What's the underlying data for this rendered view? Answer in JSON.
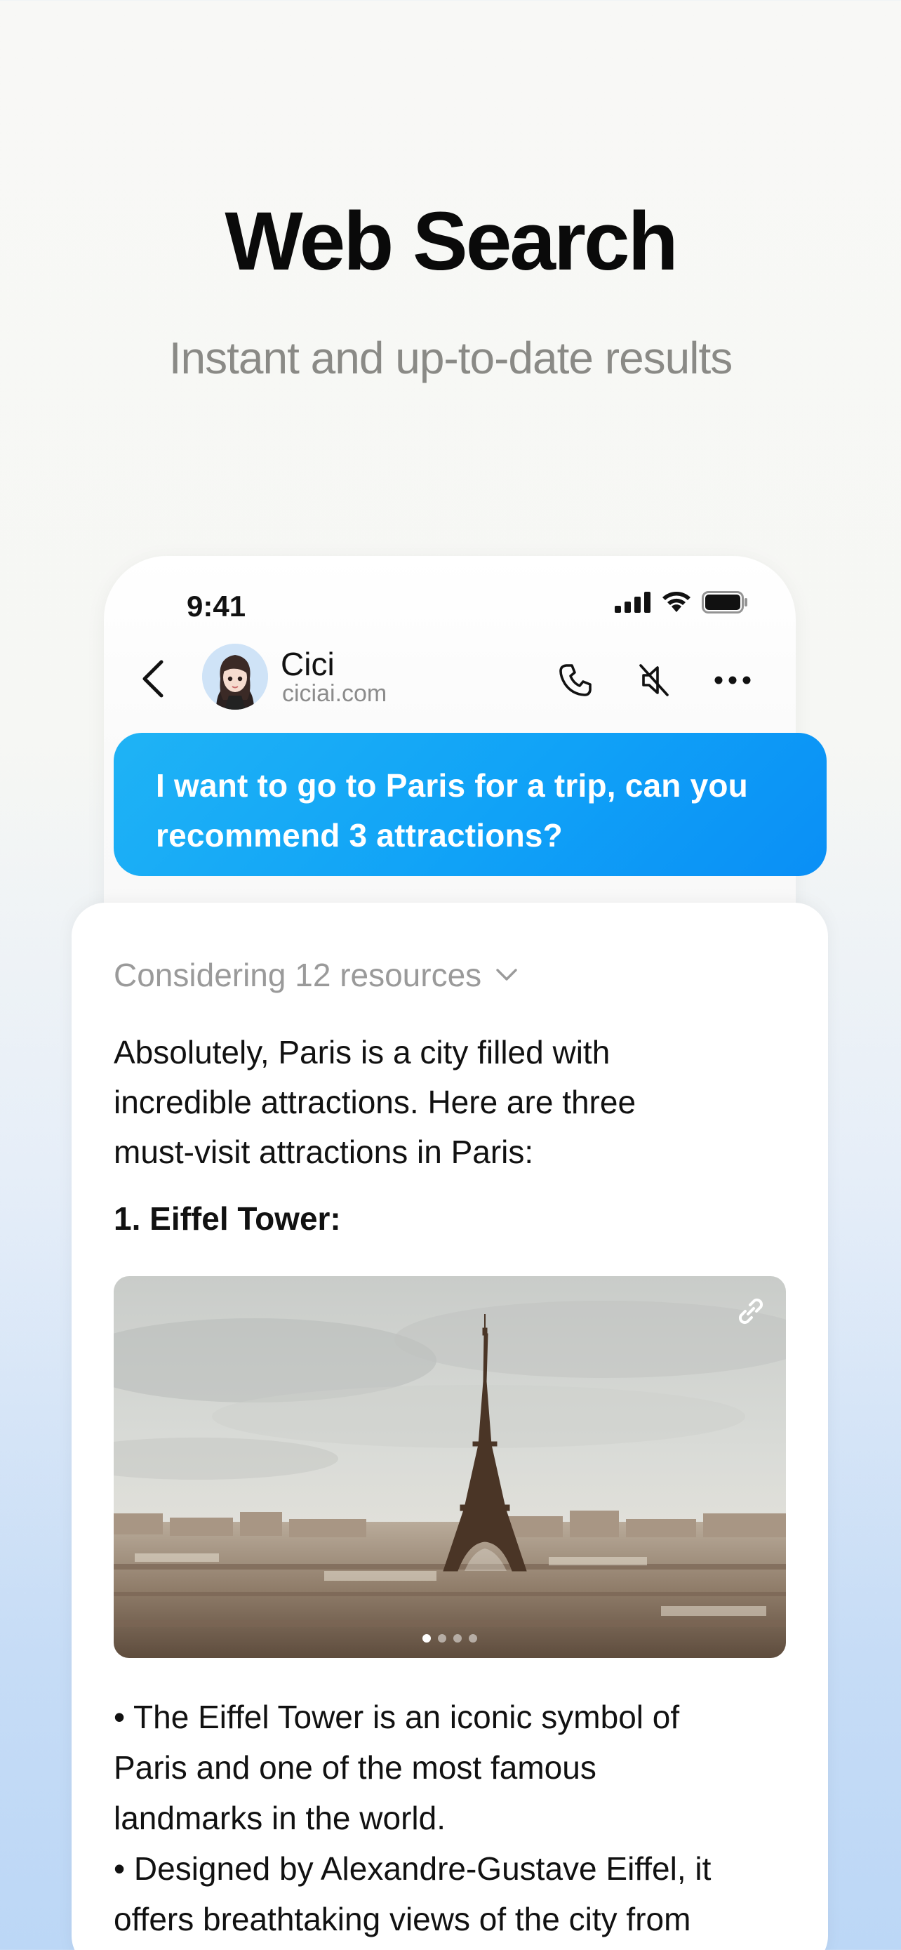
{
  "hero": {
    "title": "Web Search",
    "subtitle": "Instant and up-to-date results"
  },
  "status_bar": {
    "time": "9:41"
  },
  "chat_header": {
    "bot_name": "Cici",
    "bot_domain": "ciciai.com",
    "icons": [
      "back-arrow-icon",
      "phone-icon",
      "speaker-muted-icon",
      "more-icon"
    ]
  },
  "user_message": {
    "line1": "I want to go to Paris for a trip, can you",
    "line2": "recommend 3 attractions?"
  },
  "answer": {
    "considering": "Considering 12 resources",
    "intro_lines": [
      "Absolutely, Paris is a city filled with",
      "incredible attractions. Here are three",
      "must-visit attractions in Paris:"
    ],
    "item1_heading": "1. Eiffel Tower:",
    "carousel": {
      "active_index": 0,
      "count": 4
    },
    "bullet_lines": [
      "• The Eiffel Tower is an iconic symbol of",
      "Paris and one of the most famous",
      "landmarks in the world.",
      "• Designed by Alexandre-Gustave Eiffel, it",
      "offers breathtaking views of the city from"
    ]
  },
  "colors": {
    "bubble_start": "#1fb3f5",
    "bubble_end": "#0a8ff6",
    "muted_text": "#9a9a9a"
  }
}
